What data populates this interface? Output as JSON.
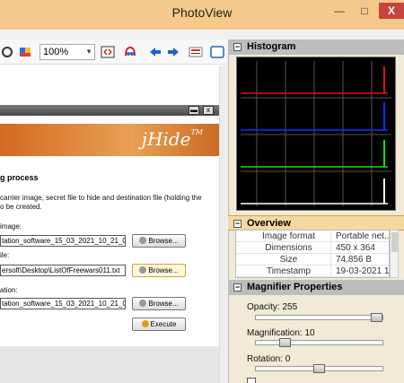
{
  "window": {
    "title": "PhotoView",
    "min": "—",
    "max": "□",
    "close": "X"
  },
  "toolbar": {
    "zoom_value": "100%",
    "icons": [
      "rotate-icon",
      "color-icon",
      "fit-icon",
      "eyes-icon",
      "back-icon",
      "forward-icon",
      "exif-icon",
      "panel-icon"
    ]
  },
  "jhide": {
    "brand": "jHide",
    "tm": "TM",
    "close": "x",
    "heading": "g process",
    "desc1": "carrier image, secret file to hide and destination file (holding the",
    "desc2": "o be created.",
    "label_image": "image:",
    "field_image": "tation_software_15_03_2021_10_21_01.png",
    "label_file": "ile:",
    "field_file": "ersoft\\Desktop\\ListOfFreewars011.txt",
    "label_dest": "ation:",
    "field_dest": "tation_software_15_03_2021_10_21_01.png",
    "browse": "Browse...",
    "execute": "Execute"
  },
  "histogram": {
    "title": "Histogram",
    "channels": [
      "red",
      "blue",
      "green",
      "white"
    ]
  },
  "overview": {
    "title": "Overview",
    "toggle": "−",
    "rows": [
      {
        "key": "Image format",
        "value": "Portable net..."
      },
      {
        "key": "Dimensions",
        "value": "450 x 364"
      },
      {
        "key": "Size",
        "value": "74,856 B"
      },
      {
        "key": "Timestamp",
        "value": "19-03-2021 1..."
      }
    ]
  },
  "magnifier": {
    "title": "Magnifier Properties",
    "toggle": "−",
    "opacity_label": "Opacity: 255",
    "opacity": 1.0,
    "magnification_label": "Magnification: 10",
    "magnification": 0.2,
    "rotation_label": "Rotation: 0",
    "rotation": 0.5
  }
}
